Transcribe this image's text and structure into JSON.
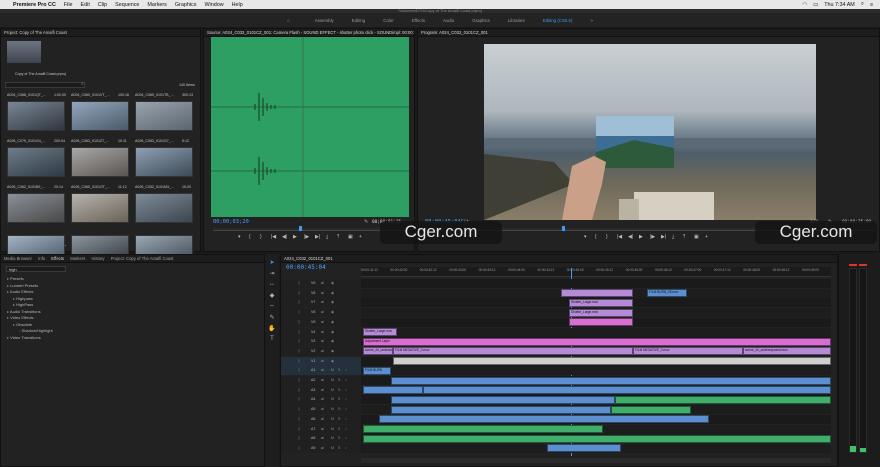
{
  "menubar": {
    "app": "Premiere Pro CC",
    "items": [
      "File",
      "Edit",
      "Clip",
      "Sequence",
      "Markers",
      "Graphics",
      "Window",
      "Help"
    ],
    "clock": "Thu 7:34 AM"
  },
  "titlebar": {
    "path": "/Volumes/DTH/Copy of The Amalfi Coast.prproj"
  },
  "workspaces": {
    "items": [
      "Assembly",
      "Editing",
      "Color",
      "Effects",
      "Audio",
      "Graphics",
      "Libraries",
      "Editing (CS5.5)"
    ],
    "active": "Editing (CS5.5)"
  },
  "project": {
    "header": "Project: Copy of The Amalfi Coast",
    "file": "Copy of The Amalfi Coast.prproj",
    "count": "140 Items",
    "clips": [
      {
        "name": "A026_C068_0101QT_...",
        "dur": "1:02:00"
      },
      {
        "name": "A026_C060_0101VT_...",
        "dur": "100:16"
      },
      {
        "name": "A026_C065_0101TB_...",
        "dur": "300:13"
      },
      {
        "name": "A026_C079_0101G4_...",
        "dur": "200:04"
      },
      {
        "name": "A026_C063_0101Z7_...",
        "dur": "10:11"
      },
      {
        "name": "A026_C053_0101G7_...",
        "dur": "5:12"
      },
      {
        "name": "A026_C062_0101B9_...",
        "dur": "20:14"
      },
      {
        "name": "A026_C060_0101OT_...",
        "dur": "11:12"
      },
      {
        "name": "A026_C052_0101M3_...",
        "dur": "10:20"
      },
      {
        "name": "",
        "dur": ""
      },
      {
        "name": "",
        "dur": ""
      },
      {
        "name": "",
        "dur": ""
      }
    ]
  },
  "source": {
    "title": "Source: A024_C032_0101CZ_001: Camera Flash - SOUND EFFECT - shutter photo click - SOUNDimpl: 00:00:44:15",
    "timecode_in": "00;00;03;20",
    "timecode_out": "00;00;01;15"
  },
  "program": {
    "title": "Program: A024_C032_0101CZ_001",
    "timecode_in": "00:00:45:04",
    "fit": "Fit",
    "quality": "1/2",
    "timecode_out": "00:00:35:09"
  },
  "watermarks": [
    "Cger.com",
    "Cger.com"
  ],
  "effects": {
    "tabs": [
      "Media Browser",
      "Info",
      "Effects",
      "Markers",
      "History",
      "Project: Copy of The Amalfi Coast"
    ],
    "active_tab": "Effects",
    "search": "high",
    "tree": [
      {
        "label": "Presets",
        "indent": 0
      },
      {
        "label": "Lumetri Presets",
        "indent": 0
      },
      {
        "label": "Audio Effects",
        "indent": 0
      },
      {
        "label": "Highpass",
        "indent": 1
      },
      {
        "label": "HighPass",
        "indent": 1
      },
      {
        "label": "Audio Transitions",
        "indent": 0
      },
      {
        "label": "Video Effects",
        "indent": 0
      },
      {
        "label": "Obsolete",
        "indent": 1
      },
      {
        "label": "Shadow/Highlight",
        "indent": 2
      },
      {
        "label": "Video Transitions",
        "indent": 0
      }
    ]
  },
  "timeline": {
    "title": "A024_C032_0101CZ_001",
    "timecode": "00:00:45:04",
    "ruler": [
      "00:00:41:12",
      "00:00:42:00",
      "00:00:42:12",
      "00:00:43:00",
      "00:00:43:12",
      "00:00:44:00",
      "00:00:44:12",
      "00:00:45:00",
      "00:00:45:12",
      "00:00:46:00",
      "00:00:46:12",
      "00:00:47:00",
      "00:00:47:12",
      "00:00:48:00",
      "00:00:48:12",
      "00:00:49:00"
    ],
    "video_tracks": [
      "V9",
      "V8",
      "V7",
      "V6",
      "V5",
      "V4",
      "V3",
      "V2",
      "V1"
    ],
    "audio_tracks": [
      "A1",
      "A2",
      "A3",
      "A4",
      "A5",
      "A6",
      "A7",
      "A8",
      "A9"
    ],
    "clip_labels": {
      "film_burn": "FILM BURN_05.mov",
      "shutter": "Shutter_Large.mov",
      "adjustment": "Adjustment Layer",
      "film_negative_a": "FILM NEGATIVE_0.mov",
      "film_negative_b": "FILM NEGATIVE_0.mov",
      "film_burn2": "FILM BURN",
      "scene_a": "scene_44_undercover",
      "scene_b": "scene_44_underexposed.mov"
    }
  },
  "colors": {
    "accent": "#3d9bf0",
    "source_wave": "#2e9f62",
    "clip_video": "#b58ad6",
    "clip_adjust": "#d86fd0",
    "clip_audio_blue": "#5b8fcf",
    "clip_audio_green": "#3fae6a"
  }
}
